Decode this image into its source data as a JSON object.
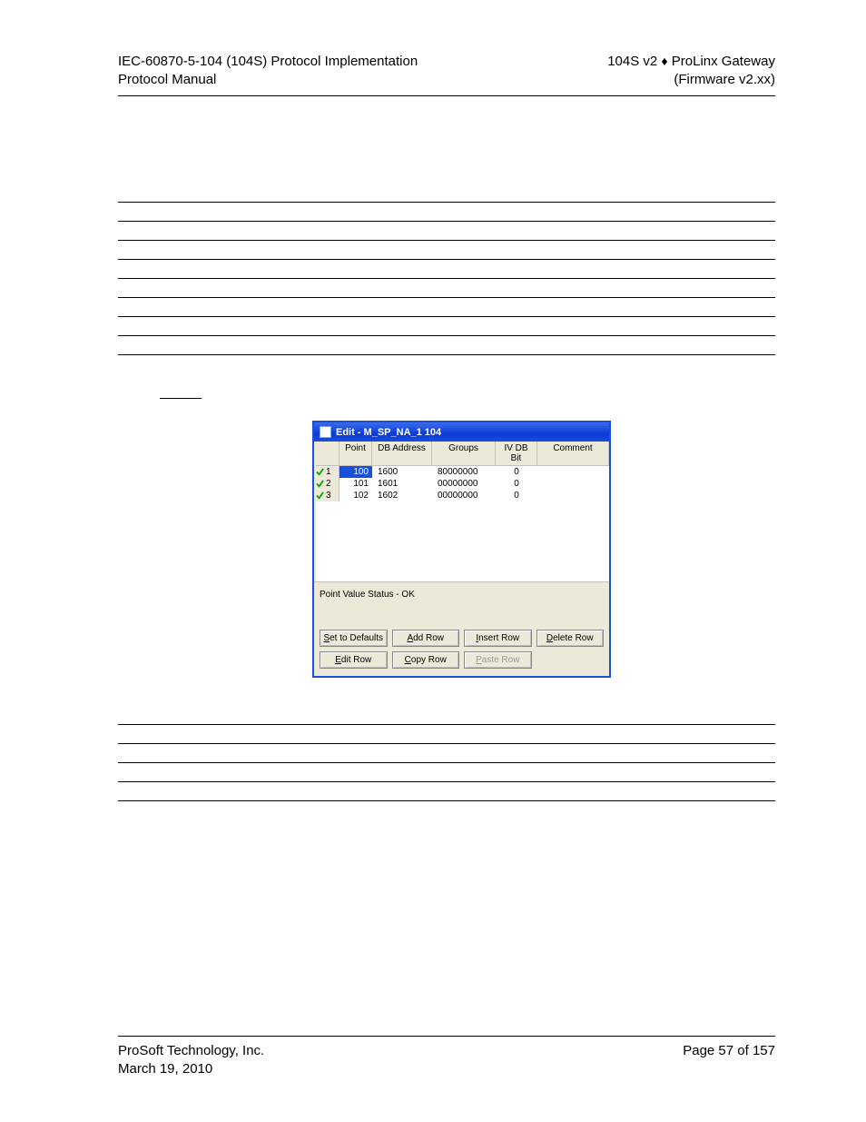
{
  "header": {
    "left_line1": "IEC-60870-5-104 (104S) Protocol Implementation",
    "left_line2": "Protocol Manual",
    "right_line1_a": "104S v2",
    "right_line1_b": "ProLinx Gateway",
    "right_line2": "(Firmware v2.xx)"
  },
  "window": {
    "title": "Edit - M_SP_NA_1 104",
    "columns": [
      "",
      "Point",
      "DB Address",
      "Groups",
      "IV DB Bit",
      "Comment"
    ],
    "rows": [
      {
        "idx": "1",
        "point": "100",
        "db": "1600",
        "groups": "80000000",
        "iv": "0",
        "comment": "",
        "selected": true
      },
      {
        "idx": "2",
        "point": "101",
        "db": "1601",
        "groups": "00000000",
        "iv": "0",
        "comment": "",
        "selected": false
      },
      {
        "idx": "3",
        "point": "102",
        "db": "1602",
        "groups": "00000000",
        "iv": "0",
        "comment": "",
        "selected": false
      }
    ],
    "status": "Point Value Status - OK",
    "buttons": {
      "set_defaults": "Set to Defaults",
      "add_row": "Add Row",
      "insert_row": "Insert Row",
      "delete_row": "Delete Row",
      "edit_row": "Edit Row",
      "copy_row": "Copy Row",
      "paste_row": "Paste Row"
    }
  },
  "footer": {
    "left_line1": "ProSoft Technology, Inc.",
    "left_line2": "March 19, 2010",
    "right": "Page 57 of 157"
  }
}
